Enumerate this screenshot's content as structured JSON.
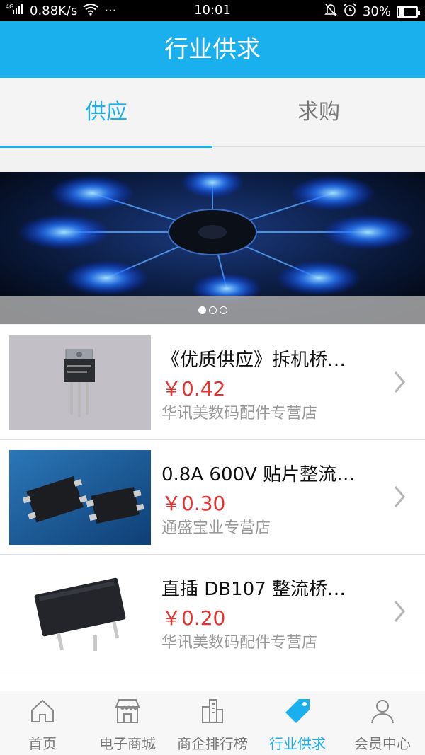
{
  "status": {
    "signal": "4G",
    "speed": "0.88K/s",
    "more": "···",
    "time": "10:01",
    "battery": "30%",
    "battery_level": 0.3
  },
  "header": {
    "title": "行业供求"
  },
  "tabs": [
    {
      "label": "供应",
      "active": true
    },
    {
      "label": "求购",
      "active": false
    }
  ],
  "banner": {
    "dots": 3,
    "active_dot": 0
  },
  "products": [
    {
      "title": "《优质供应》拆机桥…",
      "price": "￥0.42",
      "shop": "华讯美数码配件专营店"
    },
    {
      "title": "0.8A 600V 贴片整流…",
      "price": "￥0.30",
      "shop": "通盛宝业专营店"
    },
    {
      "title": "直插 DB107 整流桥…",
      "price": "￥0.20",
      "shop": "华讯美数码配件专营店"
    }
  ],
  "nav": [
    {
      "label": "首页",
      "icon": "home-icon"
    },
    {
      "label": "电子商城",
      "icon": "store-icon"
    },
    {
      "label": "商企排行榜",
      "icon": "buildings-icon"
    },
    {
      "label": "行业供求",
      "icon": "tag-icon",
      "active": true
    },
    {
      "label": "会员中心",
      "icon": "user-icon"
    }
  ],
  "colors": {
    "accent": "#1ab0ed",
    "price": "#e8302d"
  }
}
